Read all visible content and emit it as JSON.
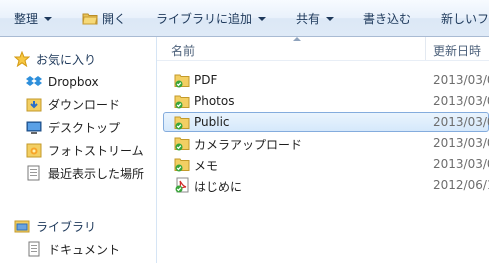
{
  "toolbar": {
    "organize": "整理",
    "open": "開く",
    "add_to_library": "ライブラリに追加",
    "share": "共有",
    "burn": "書き込む",
    "new_folder": "新しいフ"
  },
  "nav": {
    "favorites": "お気に入り",
    "items": [
      {
        "label": "Dropbox",
        "icon": "dropbox-icon"
      },
      {
        "label": "ダウンロード",
        "icon": "downloads-folder-icon"
      },
      {
        "label": "デスクトップ",
        "icon": "desktop-icon"
      },
      {
        "label": "フォトストリーム",
        "icon": "photostream-icon"
      },
      {
        "label": "最近表示した場所",
        "icon": "recent-places-icon"
      }
    ],
    "libraries": "ライブラリ",
    "documents": "ドキュメント"
  },
  "list": {
    "col_name": "名前",
    "col_date": "更新日時",
    "rows": [
      {
        "name": "PDF",
        "date": "2013/03/0",
        "icon": "synced-folder-icon",
        "selected": false
      },
      {
        "name": "Photos",
        "date": "2013/03/0",
        "icon": "synced-folder-icon",
        "selected": false
      },
      {
        "name": "Public",
        "date": "2013/03/0",
        "icon": "synced-folder-icon",
        "selected": true
      },
      {
        "name": "カメラアップロード",
        "date": "2013/03/0",
        "icon": "synced-folder-icon",
        "selected": false
      },
      {
        "name": "メモ",
        "date": "2013/03/0",
        "icon": "synced-folder-icon",
        "selected": false
      },
      {
        "name": "はじめに",
        "date": "2012/06/1",
        "icon": "synced-pdf-file-icon",
        "selected": false
      }
    ]
  }
}
